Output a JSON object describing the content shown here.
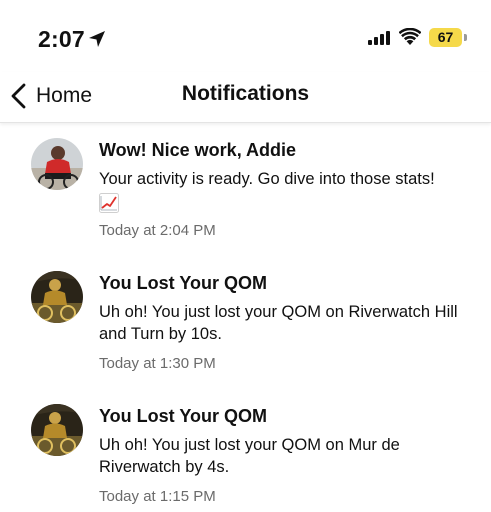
{
  "status_bar": {
    "time": "2:07",
    "battery": "67",
    "icons": [
      "location-arrow-icon",
      "cellular-signal-icon",
      "wifi-icon",
      "battery-icon"
    ]
  },
  "nav": {
    "back_label": "Home",
    "title": "Notifications"
  },
  "notifications": [
    {
      "title": "Wow! Nice work, Addie",
      "body": "Your activity is ready. Go dive into those stats!",
      "emoji": "chart-increasing-icon",
      "time": "Today at 2:04 PM"
    },
    {
      "title": "You Lost Your QOM",
      "body": "Uh oh! You just lost your QOM on Riverwatch Hill and Turn by 10s.",
      "time": "Today at 1:30 PM"
    },
    {
      "title": "You Lost Your QOM",
      "body": "Uh oh! You just lost your QOM on Mur de Riverwatch by 4s.",
      "time": "Today at 1:15 PM"
    }
  ],
  "colors": {
    "battery_fill": "#f5d94a",
    "timestamp_text": "#6b6b6b"
  }
}
